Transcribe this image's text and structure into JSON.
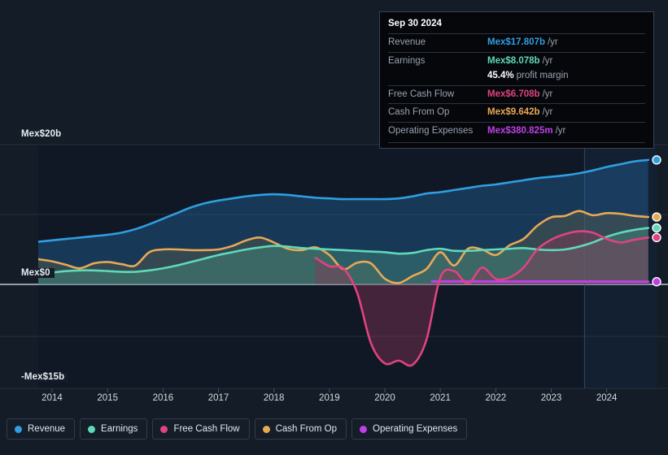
{
  "tooltip": {
    "date": "Sep 30 2024",
    "rows": [
      {
        "label": "Revenue",
        "value": "Mex$17.807b",
        "unit": "/yr",
        "color": "#2f9fe0"
      },
      {
        "label": "Earnings",
        "value": "Mex$8.078b",
        "unit": "/yr",
        "color": "#5fd9b8"
      },
      {
        "label": "",
        "value": "45.4%",
        "unit": "profit margin",
        "color": "#ffffff",
        "sub": true
      },
      {
        "label": "Free Cash Flow",
        "value": "Mex$6.708b",
        "unit": "/yr",
        "color": "#e0437f"
      },
      {
        "label": "Cash From Op",
        "value": "Mex$9.642b",
        "unit": "/yr",
        "color": "#e8a855"
      },
      {
        "label": "Operating Expenses",
        "value": "Mex$380.825m",
        "unit": "/yr",
        "color": "#c040e8"
      }
    ]
  },
  "legend": {
    "items": [
      {
        "label": "Revenue",
        "color": "#2f9fe0"
      },
      {
        "label": "Earnings",
        "color": "#5fd9b8"
      },
      {
        "label": "Free Cash Flow",
        "color": "#e0437f"
      },
      {
        "label": "Cash From Op",
        "color": "#e8a855"
      },
      {
        "label": "Operating Expenses",
        "color": "#c040e8"
      }
    ]
  },
  "chart_data": {
    "type": "area",
    "title": "",
    "xlabel": "",
    "ylabel": "",
    "ylim": [
      -15,
      20
    ],
    "yticks": [
      20,
      0,
      -15
    ],
    "ytick_labels": [
      "Mex$20b",
      "Mex$0",
      "-Mex$15b"
    ],
    "currency": "Mex$",
    "grid": true,
    "legend_position": "bottom",
    "x": [
      2014,
      2015,
      2016,
      2017,
      2018,
      2019,
      2020,
      2021,
      2022,
      2023,
      2024
    ],
    "xtick_labels": [
      "2014",
      "2015",
      "2016",
      "2017",
      "2018",
      "2019",
      "2020",
      "2021",
      "2022",
      "2023",
      "2024"
    ],
    "x_start": 2013.75,
    "x_end": 2024.9,
    "forecast_start": 2023.6,
    "series": [
      {
        "name": "Revenue",
        "color": "#2f9fe0",
        "fill": "rgba(35,95,150,0.45)",
        "x": [
          2013.75,
          2014.0,
          2014.25,
          2014.5,
          2014.75,
          2015.0,
          2015.25,
          2015.5,
          2015.75,
          2016.0,
          2016.25,
          2016.5,
          2016.75,
          2017.0,
          2017.25,
          2017.5,
          2017.75,
          2018.0,
          2018.25,
          2018.5,
          2018.75,
          2019.0,
          2019.25,
          2019.5,
          2019.75,
          2020.0,
          2020.25,
          2020.5,
          2020.75,
          2021.0,
          2021.25,
          2021.5,
          2021.75,
          2022.0,
          2022.25,
          2022.5,
          2022.75,
          2023.0,
          2023.25,
          2023.5,
          2023.75,
          2024.0,
          2024.25,
          2024.5,
          2024.75
        ],
        "y": [
          6.1,
          6.3,
          6.5,
          6.7,
          6.9,
          7.1,
          7.4,
          7.9,
          8.6,
          9.4,
          10.2,
          11.0,
          11.6,
          12.0,
          12.3,
          12.6,
          12.8,
          12.9,
          12.8,
          12.6,
          12.4,
          12.3,
          12.2,
          12.2,
          12.2,
          12.2,
          12.3,
          12.6,
          13.0,
          13.2,
          13.5,
          13.8,
          14.1,
          14.3,
          14.6,
          14.9,
          15.2,
          15.4,
          15.6,
          15.9,
          16.3,
          16.8,
          17.2,
          17.6,
          17.807
        ]
      },
      {
        "name": "Earnings",
        "color": "#5fd9b8",
        "fill": "rgba(70,150,130,0.40)",
        "x": [
          2013.75,
          2014.0,
          2014.25,
          2014.5,
          2014.75,
          2015.0,
          2015.25,
          2015.5,
          2015.75,
          2016.0,
          2016.25,
          2016.5,
          2016.75,
          2017.0,
          2017.25,
          2017.5,
          2017.75,
          2018.0,
          2018.25,
          2018.5,
          2018.75,
          2019.0,
          2019.25,
          2019.5,
          2019.75,
          2020.0,
          2020.25,
          2020.5,
          2020.75,
          2021.0,
          2021.25,
          2021.5,
          2021.75,
          2022.0,
          2022.25,
          2022.5,
          2022.75,
          2023.0,
          2023.25,
          2023.5,
          2023.75,
          2024.0,
          2024.25,
          2024.5,
          2024.75
        ],
        "y": [
          1.5,
          1.7,
          1.9,
          2.0,
          2.0,
          1.9,
          1.8,
          1.8,
          2.0,
          2.3,
          2.7,
          3.2,
          3.7,
          4.2,
          4.6,
          5.0,
          5.3,
          5.5,
          5.4,
          5.2,
          5.1,
          5.0,
          4.9,
          4.8,
          4.7,
          4.6,
          4.4,
          4.5,
          4.9,
          5.1,
          4.8,
          4.8,
          4.9,
          5.0,
          5.1,
          5.2,
          5.0,
          4.9,
          5.0,
          5.4,
          6.0,
          6.8,
          7.4,
          7.8,
          8.078
        ]
      },
      {
        "name": "Free Cash Flow",
        "color": "#e0437f",
        "fill": "rgba(140,55,85,0.42)",
        "x": [
          2018.75,
          2019.0,
          2019.25,
          2019.5,
          2019.75,
          2020.0,
          2020.25,
          2020.5,
          2020.75,
          2021.0,
          2021.25,
          2021.5,
          2021.75,
          2022.0,
          2022.25,
          2022.5,
          2022.75,
          2023.0,
          2023.25,
          2023.5,
          2023.75,
          2024.0,
          2024.25,
          2024.5,
          2024.75
        ],
        "y": [
          3.8,
          2.6,
          2.3,
          -1.2,
          -8.5,
          -11.4,
          -11.0,
          -11.6,
          -8.0,
          1.0,
          1.9,
          0.1,
          2.4,
          0.8,
          1.0,
          2.4,
          5.0,
          6.4,
          7.2,
          7.6,
          7.4,
          6.5,
          6.0,
          6.4,
          6.708
        ]
      },
      {
        "name": "Cash From Op",
        "color": "#e8a855",
        "fill": "rgba(120,110,70,0.30)",
        "x": [
          2013.75,
          2014.0,
          2014.25,
          2014.5,
          2014.75,
          2015.0,
          2015.25,
          2015.5,
          2015.75,
          2016.0,
          2016.25,
          2016.5,
          2016.75,
          2017.0,
          2017.25,
          2017.5,
          2017.75,
          2018.0,
          2018.25,
          2018.5,
          2018.75,
          2019.0,
          2019.25,
          2019.5,
          2019.75,
          2020.0,
          2020.25,
          2020.5,
          2020.75,
          2021.0,
          2021.25,
          2021.5,
          2021.75,
          2022.0,
          2022.25,
          2022.5,
          2022.75,
          2023.0,
          2023.25,
          2023.5,
          2023.75,
          2024.0,
          2024.25,
          2024.5,
          2024.75
        ],
        "y": [
          3.6,
          3.3,
          2.8,
          2.3,
          3.0,
          3.2,
          2.9,
          2.7,
          4.6,
          5.0,
          5.0,
          4.9,
          4.9,
          5.0,
          5.5,
          6.3,
          6.7,
          6.0,
          5.1,
          4.9,
          5.3,
          4.2,
          2.2,
          3.1,
          3.0,
          0.8,
          0.2,
          1.2,
          2.2,
          4.6,
          2.7,
          5.1,
          5.0,
          4.2,
          5.6,
          6.5,
          8.4,
          9.6,
          9.8,
          10.5,
          9.9,
          10.2,
          10.1,
          9.8,
          9.642
        ]
      },
      {
        "name": "Operating Expenses",
        "color": "#c040e8",
        "fill": "rgba(120,60,150,0.26)",
        "x": [
          2020.85,
          2021.5,
          2022.0,
          2022.5,
          2023.0,
          2023.5,
          2024.0,
          2024.5,
          2024.75
        ],
        "y": [
          0.42,
          0.42,
          0.41,
          0.41,
          0.4,
          0.4,
          0.39,
          0.385,
          0.380825
        ]
      }
    ],
    "endpoints": [
      {
        "name": "Revenue",
        "color": "#2f9fe0",
        "value": 17.807
      },
      {
        "name": "Cash From Op",
        "color": "#e8a855",
        "value": 9.642
      },
      {
        "name": "Earnings",
        "color": "#5fd9b8",
        "value": 8.078
      },
      {
        "name": "Free Cash Flow",
        "color": "#e0437f",
        "value": 6.708
      },
      {
        "name": "Operating Expenses",
        "color": "#c040e8",
        "value": 0.380825
      }
    ]
  }
}
